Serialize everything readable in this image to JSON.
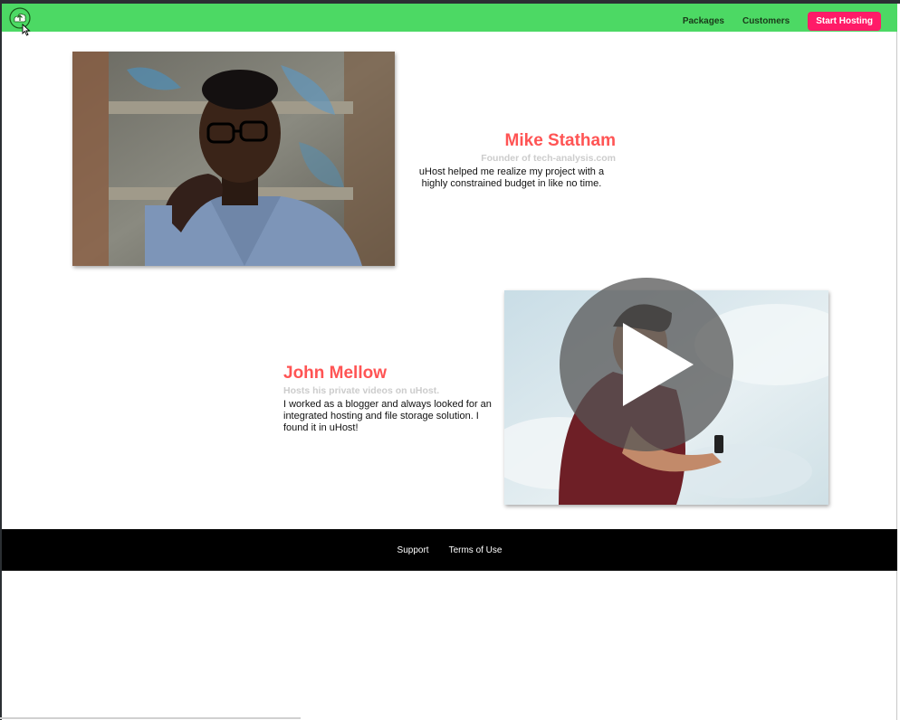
{
  "header": {
    "logo_icon": "cloud-upload-icon",
    "nav": {
      "packages": "Packages",
      "customers": "Customers",
      "start_hosting": "Start Hosting"
    },
    "colors": {
      "bar": "#4cd964",
      "cta": "#ff1b68"
    }
  },
  "testimonials": [
    {
      "name": "Mike Statham",
      "subtitle": "Founder of tech-analysis.com",
      "text": "uHost helped me realize my project with a highly constrained budget in like no time."
    },
    {
      "name": "John Mellow",
      "subtitle": "Hosts his private videos on uHost.",
      "text": "I worked as a blogger and always looked for an integrated hosting and file storage solution. I found it in uHost!"
    }
  ],
  "video": {
    "play_icon": "play-icon"
  },
  "footer": {
    "support": "Support",
    "terms": "Terms of Use"
  },
  "colors": {
    "name": "#ff5454",
    "subtitle": "#cccccc",
    "footer": "#000000"
  }
}
